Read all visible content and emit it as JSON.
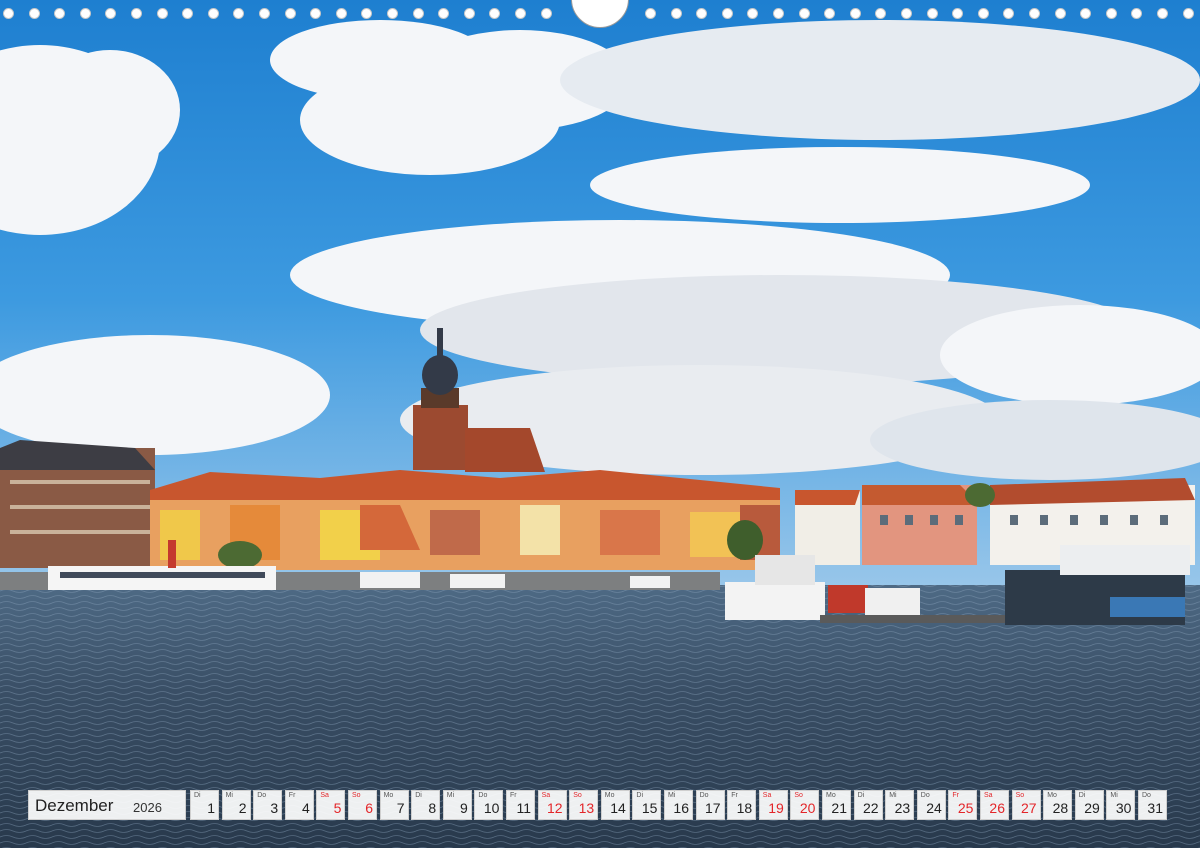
{
  "calendar": {
    "month": "Dezember",
    "year": "2026",
    "days": [
      {
        "wd": "Di",
        "d": "1",
        "we": false
      },
      {
        "wd": "Mi",
        "d": "2",
        "we": false
      },
      {
        "wd": "Do",
        "d": "3",
        "we": false
      },
      {
        "wd": "Fr",
        "d": "4",
        "we": false
      },
      {
        "wd": "Sa",
        "d": "5",
        "we": true
      },
      {
        "wd": "So",
        "d": "6",
        "we": true
      },
      {
        "wd": "Mo",
        "d": "7",
        "we": false
      },
      {
        "wd": "Di",
        "d": "8",
        "we": false
      },
      {
        "wd": "Mi",
        "d": "9",
        "we": false
      },
      {
        "wd": "Do",
        "d": "10",
        "we": false
      },
      {
        "wd": "Fr",
        "d": "11",
        "we": false
      },
      {
        "wd": "Sa",
        "d": "12",
        "we": true
      },
      {
        "wd": "So",
        "d": "13",
        "we": true
      },
      {
        "wd": "Mo",
        "d": "14",
        "we": false
      },
      {
        "wd": "Di",
        "d": "15",
        "we": false
      },
      {
        "wd": "Mi",
        "d": "16",
        "we": false
      },
      {
        "wd": "Do",
        "d": "17",
        "we": false
      },
      {
        "wd": "Fr",
        "d": "18",
        "we": false
      },
      {
        "wd": "Sa",
        "d": "19",
        "we": true
      },
      {
        "wd": "So",
        "d": "20",
        "we": true
      },
      {
        "wd": "Mo",
        "d": "21",
        "we": false
      },
      {
        "wd": "Di",
        "d": "22",
        "we": false
      },
      {
        "wd": "Mi",
        "d": "23",
        "we": false
      },
      {
        "wd": "Do",
        "d": "24",
        "we": false
      },
      {
        "wd": "Fr",
        "d": "25",
        "we": true
      },
      {
        "wd": "Sa",
        "d": "26",
        "we": true
      },
      {
        "wd": "So",
        "d": "27",
        "we": true
      },
      {
        "wd": "Mo",
        "d": "28",
        "we": false
      },
      {
        "wd": "Di",
        "d": "29",
        "we": false
      },
      {
        "wd": "Mi",
        "d": "30",
        "we": false
      },
      {
        "wd": "Do",
        "d": "31",
        "we": false
      }
    ]
  },
  "colors": {
    "sky": "#2e8fd6",
    "water": "#3a4f66",
    "roof": "#d4683a",
    "weekend": "#e3262a"
  }
}
